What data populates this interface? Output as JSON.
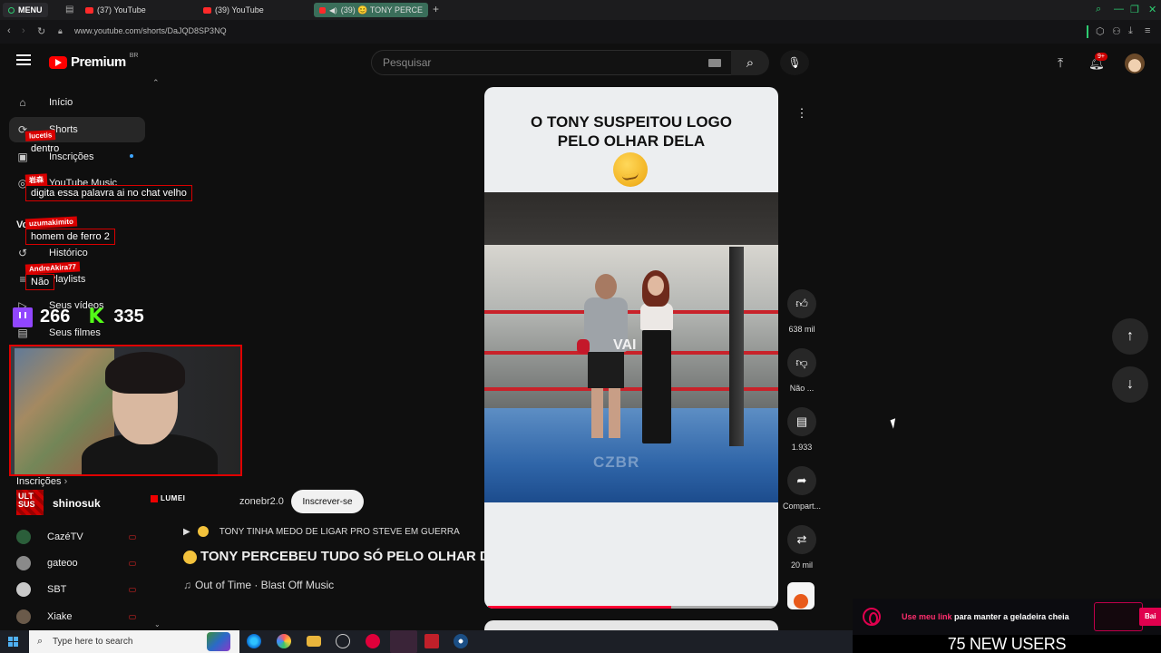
{
  "browser": {
    "menu_label": "MENU",
    "tabs": [
      {
        "label": "(37) YouTube",
        "active": false
      },
      {
        "label": "(39) YouTube",
        "active": false
      },
      {
        "label": "(39) 😊 TONY PERCE",
        "active": true
      }
    ],
    "new_tab": "+",
    "url": "www.youtube.com/shorts/DaJQD8SP3NQ"
  },
  "youtube": {
    "logo_text": "Premium",
    "logo_region": "BR",
    "search_placeholder": "Pesquisar",
    "notifications_badge": "9+"
  },
  "sidebar": {
    "items": [
      {
        "icon": "home-icon",
        "label": "Início"
      },
      {
        "icon": "shorts-icon",
        "label": "Shorts"
      },
      {
        "icon": "subscriptions-icon",
        "label": "Inscrições"
      },
      {
        "icon": "music-icon",
        "label": "YouTube Music"
      },
      {
        "icon": "you-icon",
        "label": "Você"
      },
      {
        "icon": "history-icon",
        "label": "Histórico"
      },
      {
        "icon": "playlists-icon",
        "label": "Playlists"
      },
      {
        "icon": "your-videos-icon",
        "label": "Seus vídeos"
      },
      {
        "icon": "your-movies-icon",
        "label": "Seus filmes"
      }
    ],
    "subscriptions_header": "Inscrições",
    "channels": [
      {
        "name": "CazéTV",
        "color": "#2b5e3a"
      },
      {
        "name": "gateoo",
        "color": "#8a8a8a"
      },
      {
        "name": "SBT",
        "color": "#c9c9c9"
      },
      {
        "name": "Xiake",
        "color": "#6a5a4a"
      }
    ]
  },
  "chat": [
    {
      "user": "lucetis",
      "message": "dentro"
    },
    {
      "user": "岩森",
      "message": "digita essa palavra ai no chat velho"
    },
    {
      "user": "uzumakimito",
      "message": "homem de ferro 2"
    },
    {
      "user": "AndreAkira77",
      "message": "Não"
    }
  ],
  "stream_stats": {
    "twitch_viewers": "266",
    "kick_viewers": "335"
  },
  "short": {
    "caption_line1": "O TONY SUSPEITOU LOGO",
    "caption_line2": "PELO OLHAR DELA",
    "overlay_word": "VAI",
    "watermark": "CZBR",
    "progress": 0.64,
    "channel_handle": "shinosuk",
    "channel_name": "zonebr2.0",
    "subscribe_label": "Inscrever-se",
    "related_title": "TONY TINHA MEDO DE LIGAR PRO STEVE EM GUERRA",
    "title": "TONY PERCEBEU TUDO SÓ PELO OLHAR D...",
    "music": "Out of Time · Blast Off Music",
    "ult_logo": "ULT SUS",
    "lumei_logo": "LUMEI"
  },
  "actions": {
    "likes": "638 mil",
    "dislike_label": "Não ...",
    "comments": "1.933",
    "share_label": "Compart...",
    "remix_count": "20 mil"
  },
  "taskbar": {
    "search_placeholder": "Type here to search"
  },
  "alerts": {
    "text_highlight": "Use meu link",
    "text_rest": "para manter a geladeira cheia",
    "button": "Bai",
    "new_users": "75 NEW USERS"
  }
}
